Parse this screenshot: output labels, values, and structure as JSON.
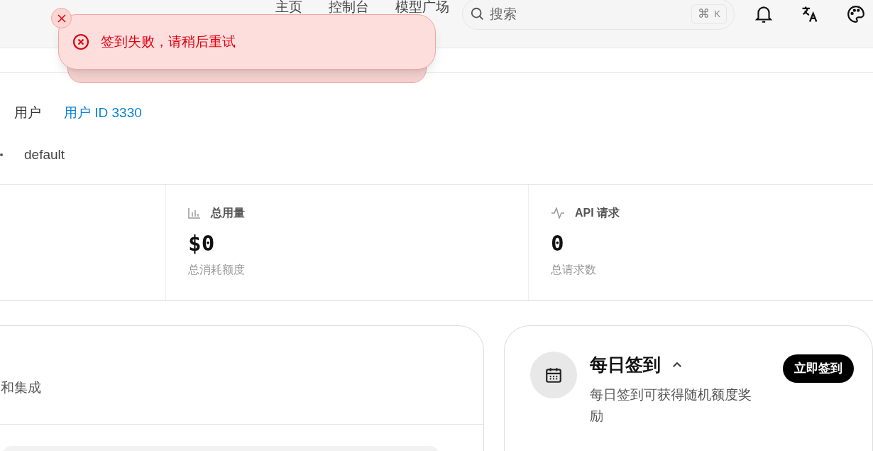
{
  "nav": {
    "links": [
      "主页",
      "控制台",
      "模型广场"
    ],
    "search": {
      "placeholder": "搜索",
      "shortcut": [
        "⌘",
        "K"
      ]
    }
  },
  "toast": {
    "message": "签到失败，请稍后重试"
  },
  "user": {
    "label": "用户",
    "user_id": "用户 ID 3330",
    "group": "default"
  },
  "stats": [
    {
      "kind": "usage",
      "title": "总用量",
      "value": "$0",
      "caption": "总消耗额度"
    },
    {
      "kind": "requests",
      "title": "API 请求",
      "value": "0",
      "caption": "总请求数"
    }
  ],
  "left_card": {
    "text": "和集成"
  },
  "checkin": {
    "title": "每日签到",
    "expanded": true,
    "description": "每日签到可获得随机额度奖励",
    "button": "立即签到"
  }
}
